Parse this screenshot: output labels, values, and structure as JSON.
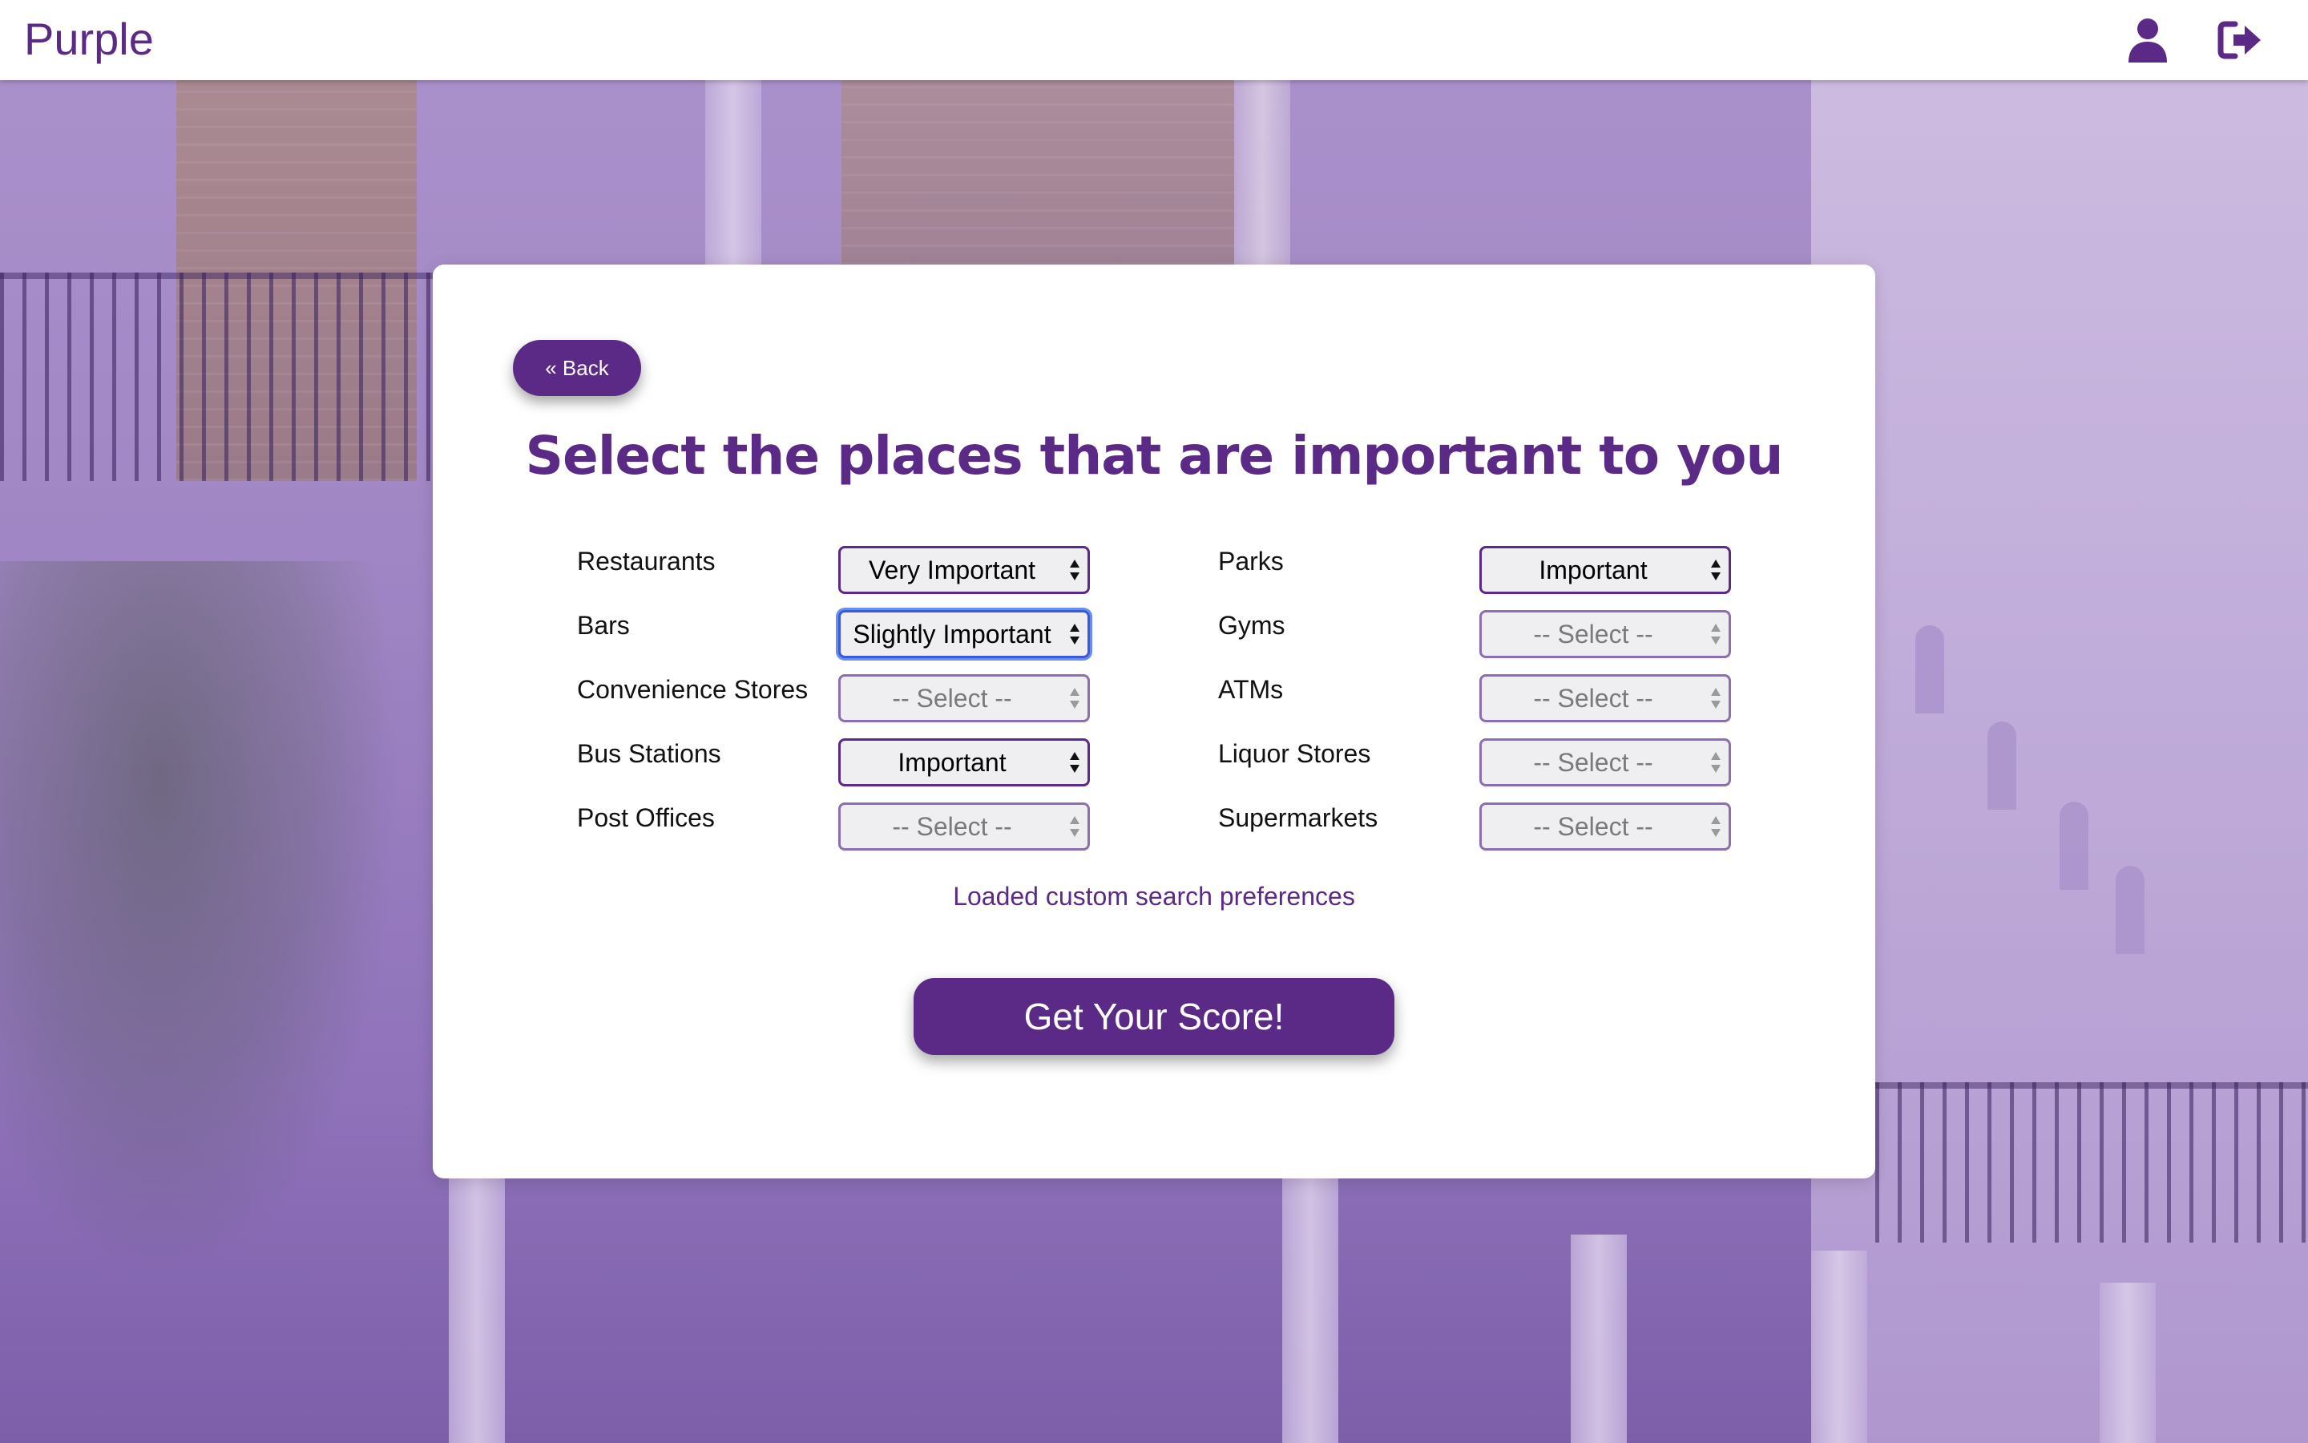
{
  "app": {
    "brand": "Purple"
  },
  "header": {
    "profile_icon": "user-icon",
    "logout_icon": "sign-out-icon"
  },
  "card": {
    "back_label": "« Back",
    "title": "Select the places that are important to you",
    "status_message": "Loaded custom search preferences",
    "submit_label": "Get Your Score!"
  },
  "preferences": {
    "left": [
      {
        "label": "Restaurants",
        "value": "Very Important"
      },
      {
        "label": "Bars",
        "value": "Slightly Important"
      },
      {
        "label": "Convenience Stores",
        "value": "--  Select  --"
      },
      {
        "label": "Bus Stations",
        "value": "Important"
      },
      {
        "label": "Post Offices",
        "value": "--  Select  --"
      }
    ],
    "right": [
      {
        "label": "Parks",
        "value": "Important"
      },
      {
        "label": "Gyms",
        "value": "--  Select  --"
      },
      {
        "label": "ATMs",
        "value": "--  Select  --"
      },
      {
        "label": "Liquor Stores",
        "value": "--  Select  --"
      },
      {
        "label": "Supermarkets",
        "value": "--  Select  --"
      }
    ]
  },
  "colors": {
    "brand": "#5b2a86",
    "focus_ring": "#3b5ad9"
  }
}
